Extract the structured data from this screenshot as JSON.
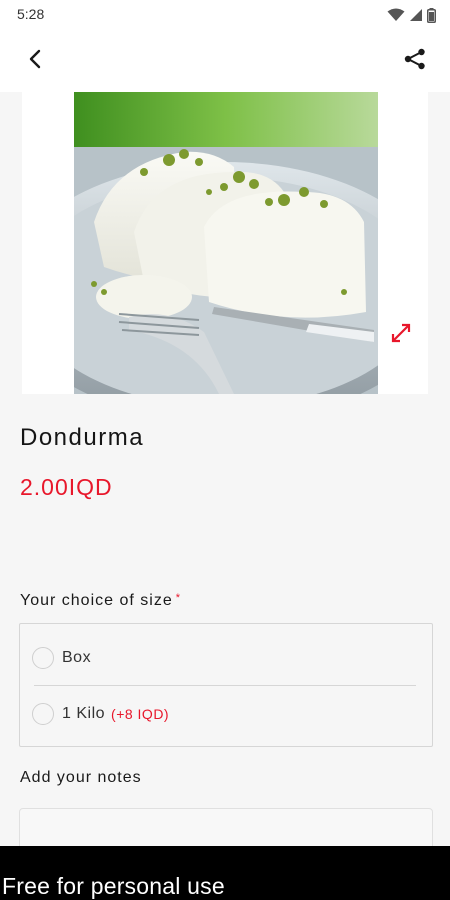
{
  "status_bar": {
    "time": "5:28",
    "icons": [
      "wifi-icon",
      "signal-icon",
      "battery-icon"
    ]
  },
  "app_bar": {
    "back_icon": "chevron-left-icon",
    "share_icon": "share-icon"
  },
  "product": {
    "name": "Dondurma",
    "price": "2.00IQD",
    "image_alt": "dessert-photo"
  },
  "size_section": {
    "title": "Your choice of size",
    "required_marker": "*",
    "options": [
      {
        "label": "Box",
        "extra": ""
      },
      {
        "label": "1 Kilo",
        "extra": "(+8 IQD)"
      }
    ]
  },
  "notes_section": {
    "title": "Add your notes",
    "value": ""
  },
  "watermark": "Free for personal use",
  "colors": {
    "accent": "#e8172b",
    "background": "#f6f6f6",
    "text": "#151515"
  }
}
